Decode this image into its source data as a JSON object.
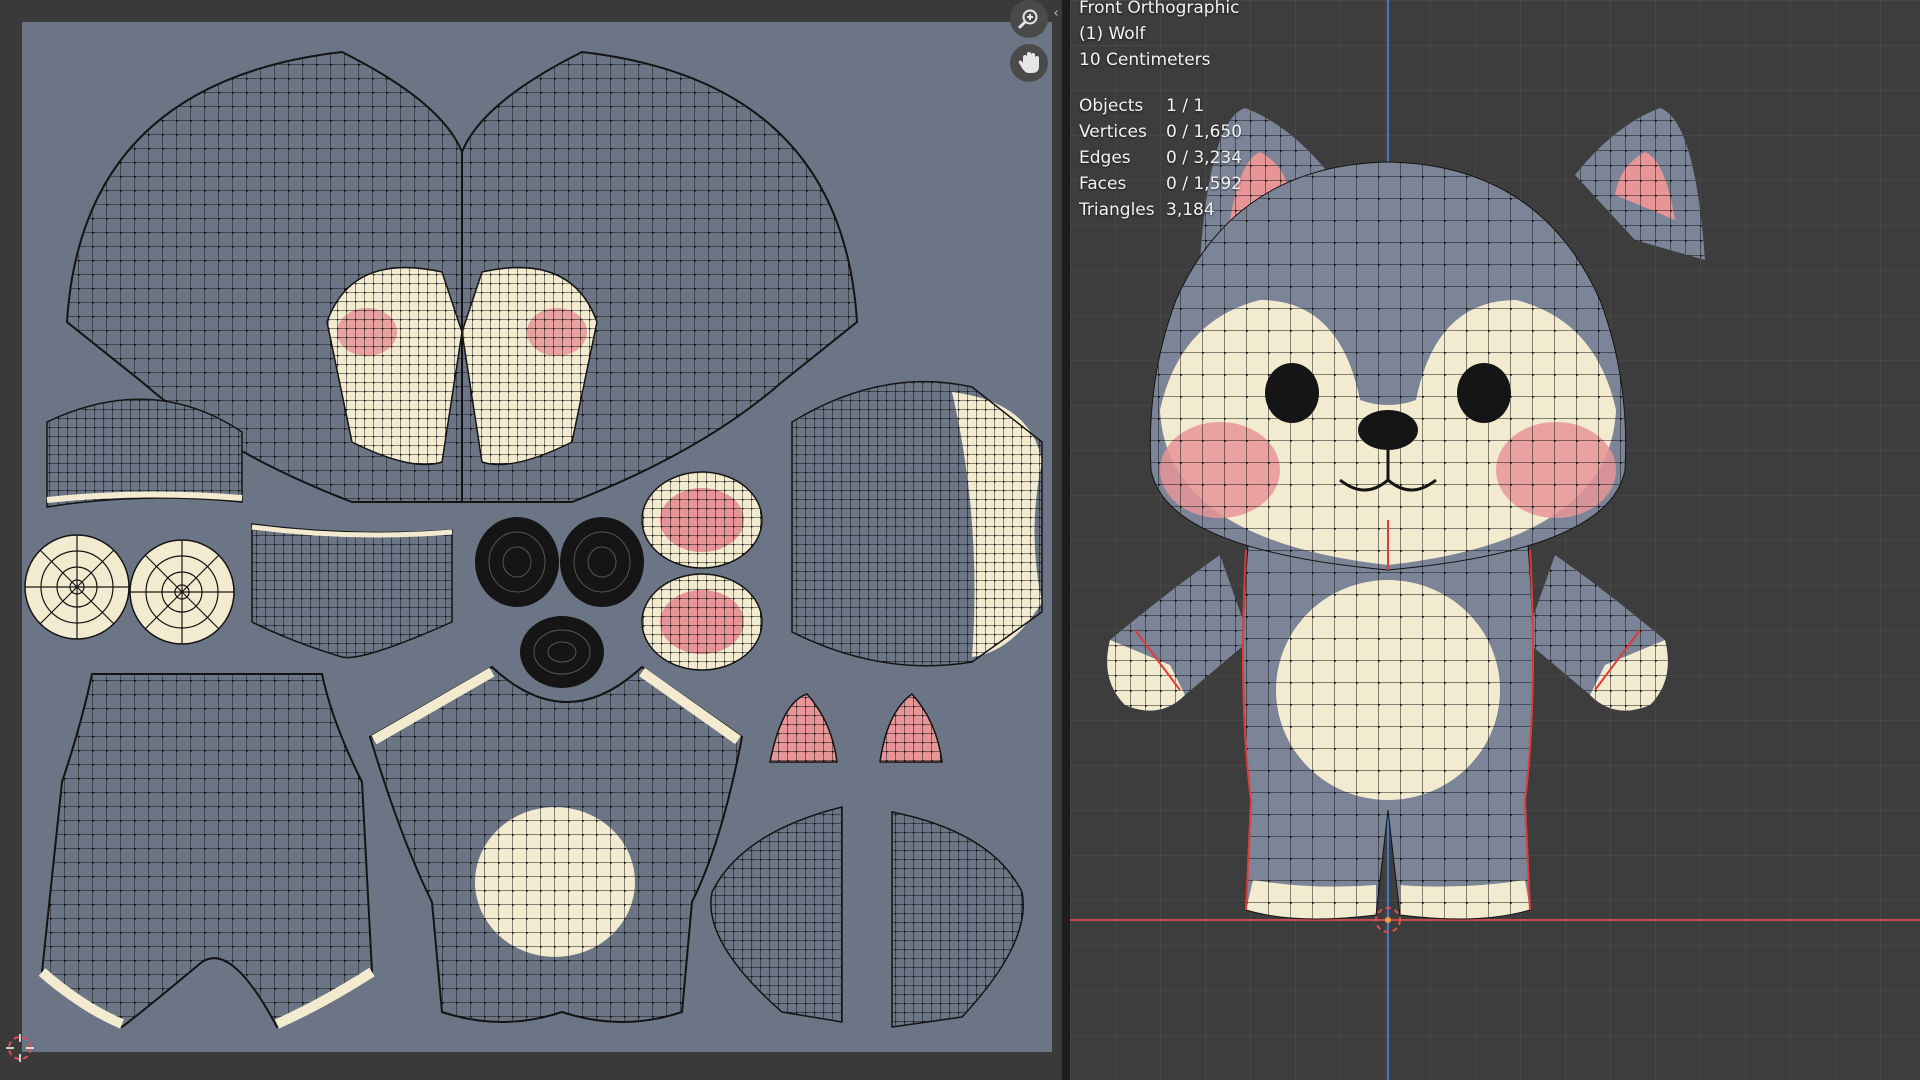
{
  "uv_editor": {
    "texture_colors": {
      "body": "#6b7585",
      "cream": "#f3ebd0",
      "pink": "#e89598",
      "eye": "#151515",
      "wire": "#141414"
    }
  },
  "viewport": {
    "view_name": "Front Orthographic",
    "object_name": "(1) Wolf",
    "scale": "10 Centimeters",
    "stats": [
      {
        "label": "Objects",
        "value": "1 / 1"
      },
      {
        "label": "Vertices",
        "value": "0 / 1,650"
      },
      {
        "label": "Edges",
        "value": "0 / 3,234"
      },
      {
        "label": "Faces",
        "value": "0 / 1,592"
      },
      {
        "label": "Triangles",
        "value": "3,184"
      }
    ],
    "colors": {
      "background": "#3d3d3d",
      "x_axis": "#c94b4b",
      "z_axis": "#4a76c4",
      "seam": "#e03a3a"
    }
  },
  "icons": {
    "zoom": "zoom-in-icon",
    "pan": "hand-icon",
    "cursor": "3d-cursor-icon",
    "collapse": "chevron-left-right-icon"
  }
}
